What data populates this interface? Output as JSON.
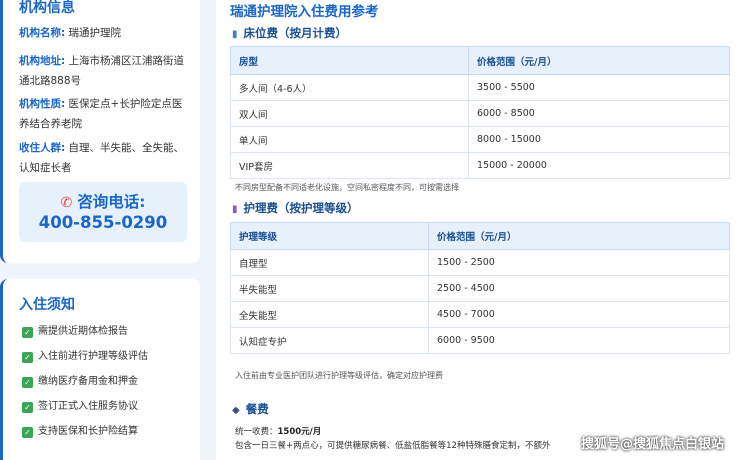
{
  "info": {
    "title": "机构信息",
    "rows": [
      {
        "label": "机构名称:",
        "value": "瑞通护理院"
      },
      {
        "label": "机构地址:",
        "value": "上海市杨浦区江浦路街道通北路888号"
      },
      {
        "label": "机构性质:",
        "value": "医保定点+长护险定点医养结合养老院"
      },
      {
        "label": "收住人群:",
        "value": "自理、半失能、全失能、认知症长者"
      }
    ],
    "phone_label": "咨询电话:",
    "phone_number": "400-855-0290"
  },
  "notice": {
    "title": "入住须知",
    "items": [
      "需提供近期体检报告",
      "入住前进行护理等级评估",
      "缴纳医疗备用金和押金",
      "签订正式入住服务协议",
      "支持医保和长护险结算"
    ]
  },
  "main": {
    "title": "瑞通护理院入住费用参考",
    "bed": {
      "title": "床位费（按月计费）",
      "headers": [
        "房型",
        "价格范围（元/月）"
      ],
      "rows": [
        [
          "多人间（4-6人）",
          "3500 - 5500"
        ],
        [
          "双人间",
          "6000 - 8500"
        ],
        [
          "单人间",
          "8000 - 15000"
        ],
        [
          "VIP套房",
          "15000 - 20000"
        ]
      ],
      "note": "不同房型配备不同适老化设施，空间私密程度不同，可按需选择"
    },
    "care": {
      "title": "护理费（按护理等级）",
      "headers": [
        "护理等级",
        "价格范围（元/月）"
      ],
      "rows": [
        [
          "自理型",
          "1500 - 2500"
        ],
        [
          "半失能型",
          "2500 - 4500"
        ],
        [
          "全失能型",
          "4500 - 7000"
        ],
        [
          "认知症专护",
          "6000 - 9500"
        ]
      ],
      "note": "入住前由专业医护团队进行护理等级评估，确定对应护理费"
    },
    "meal": {
      "title": "餐费",
      "line1_prefix": "统一收费：",
      "line1_value": "1500元/月",
      "line2": "包含一日三餐+两点心，可提供糖尿病餐、低盐低脂餐等12种特殊膳食定制，不额外"
    }
  },
  "watermark": "搜狐号@搜狐焦点白银站",
  "colors": {
    "accent": "#1a67c8",
    "phone_icon": "#e0473c",
    "check": "#3aa655",
    "header_bg": "#e6f1fb"
  }
}
